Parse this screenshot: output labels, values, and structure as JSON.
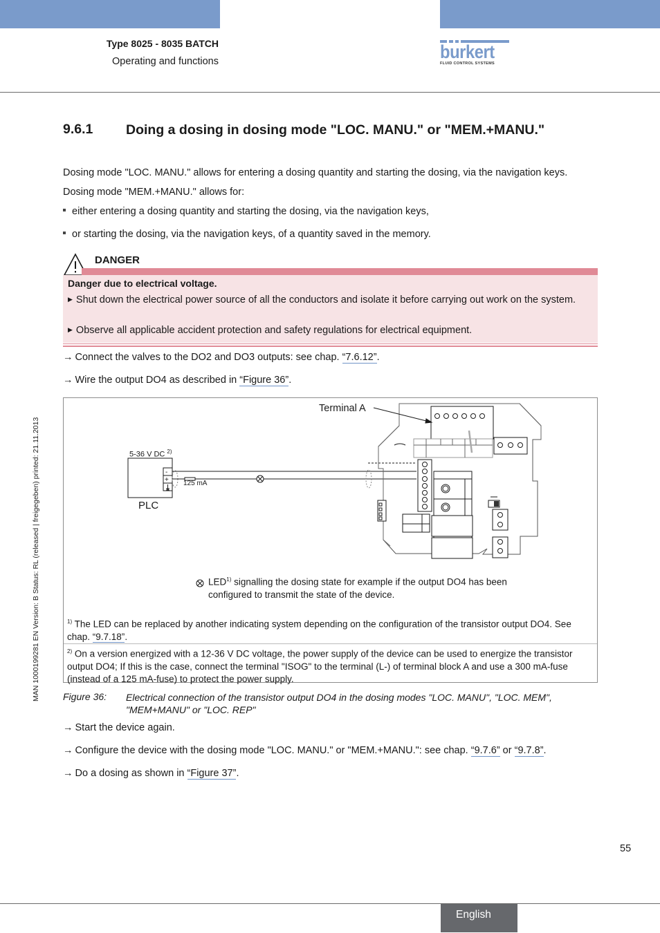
{
  "header": {
    "doc_title": "Type 8025 - 8035 BATCH",
    "doc_subtitle": "Operating and functions",
    "brand_name": "burkert",
    "brand_tagline": "FLUID CONTROL SYSTEMS",
    "colors": {
      "band": "#7a9bcb",
      "danger": "#e08a96",
      "danger_bg": "#f7e3e5",
      "link_underline": "#6f93c7",
      "lang_tab": "#66686c"
    }
  },
  "side_note": "MAN  1000199281  EN  Version: B  Status: RL (released | freigegeben)  printed: 21.11.2013",
  "section": {
    "number": "9.6.1",
    "title": "Doing a dosing in dosing mode \"LOC. MANU.\" or \"MEM.+MANU.\"",
    "paragraphs": [
      "Dosing mode \"LOC. MANU.\" allows for entering a dosing quantity and starting the dosing, via the navigation keys.",
      "Dosing mode \"MEM.+MANU.\" allows for:"
    ],
    "bullets": [
      "either entering a dosing quantity and starting the dosing, via the navigation keys,",
      "or starting the dosing, via the navigation keys, of a quantity saved in the memory."
    ]
  },
  "danger": {
    "label": "DANGER",
    "title": "Danger due to electrical voltage.",
    "items": [
      "Shut down the electrical power source of all the conductors and isolate it before carrying out work on the system.",
      "Observe all applicable accident protection and safety regulations for electrical equipment."
    ]
  },
  "steps_before": [
    {
      "arrow": "→",
      "text": "Connect the valves to the DO2 and DO3 outputs: see chap. ",
      "link": "“7.6.12”",
      "after": "."
    },
    {
      "arrow": "→",
      "text": "Wire the output DO4 as described in ",
      "link": "“Figure 36”",
      "after": "."
    }
  ],
  "figure": {
    "terminal_label": "Terminal A",
    "supply_label": "5-36 V DC",
    "supply_sup": "2)",
    "plc_label": "PLC",
    "fuse_label": "125 mA",
    "plc_terminals": [
      "-",
      "+",
      "⏚"
    ],
    "led_legend_sup": "1)",
    "led_legend_prefix": "LED",
    "led_legend_text": " signalling the dosing state for example if the output DO4 has been configured to transmit the state of the device.",
    "footnotes": [
      {
        "sup": "1)",
        "text": " The LED can be replaced by another indicating system depending on the configuration of the transistor output DO4. See chap. ",
        "link": "“9.7.18”",
        "after": "."
      },
      {
        "sup": "2)",
        "text": " On a version energized with a 12-36 V DC voltage, the power supply of the device can be used to energize the transistor output DO4; If this is the case, connect the terminal \"ISOG\" to the terminal (L-) of terminal block A and use a  300 mA-fuse (instead of a 125 mA-fuse) to protect the power supply."
      }
    ],
    "caption_number": "Figure 36:",
    "caption_text": "Electrical connection of the transistor output DO4 in the dosing modes \"LOC. MANU\", \"LOC. MEM\", \"MEM+MANU\" or \"LOC. REP\""
  },
  "steps_after": [
    {
      "arrow": "→",
      "text": "Start the device again."
    },
    {
      "arrow": "→",
      "text": "Configure the device with the dosing mode \"LOC. MANU.\" or \"MEM.+MANU.\": see chap. ",
      "link": "“9.7.6”",
      "mid": " or ",
      "link2": "“9.7.8”",
      "after": "."
    },
    {
      "arrow": "→",
      "text": "Do a dosing as shown in ",
      "link": "“Figure 37”",
      "after": "."
    }
  ],
  "footer": {
    "page_number": "55",
    "language": "English"
  }
}
